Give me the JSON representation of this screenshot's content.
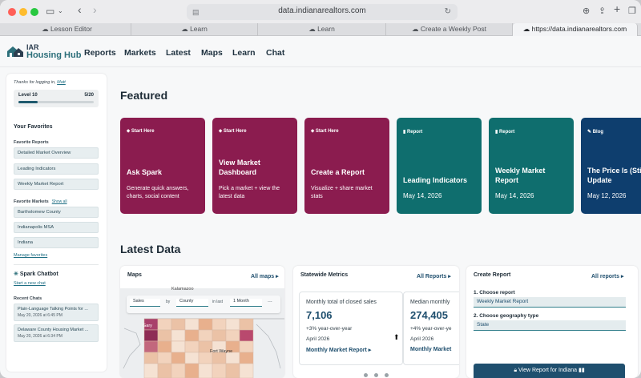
{
  "browser": {
    "url": "data.indianarealtors.com",
    "tabs": [
      "Lesson Editor",
      "Learn",
      "Learn",
      "Create a Weekly Post",
      "https://data.indianarealtors.com"
    ]
  },
  "site": {
    "logo_top": "IAR",
    "logo_bottom": "Housing Hub",
    "nav": [
      "Reports",
      "Markets",
      "Latest",
      "Maps",
      "Learn",
      "Chat"
    ]
  },
  "sidebar": {
    "thanks_prefix": "Thanks for logging in,",
    "user": "Matt",
    "level_label": "Level 10",
    "level_count": "5/20",
    "level_progress": 0.25,
    "favorites_heading": "Your Favorites",
    "favorite_reports_heading": "Favorite Reports",
    "favorite_reports": [
      "Detailed Market Overview",
      "Leading Indicators",
      "Weekly Market Report"
    ],
    "favorite_markets_heading": "Favorite Markets",
    "show_all": "Show all",
    "favorite_markets": [
      "Bartholomew County",
      "Indianapolis MSA",
      "Indiana"
    ],
    "manage_favorites": "Manage favorites",
    "chatbot_heading": "Spark Chatbot",
    "start_chat": "Start a new chat",
    "recent_chats_heading": "Recent Chats",
    "recent_chats": [
      {
        "title": "Plain-Language Talking Points for ...",
        "date": "May 20, 2026 at 6:45 PM"
      },
      {
        "title": "Delaware County Housing Market ...",
        "date": "May 20, 2026 at 6:34 PM"
      }
    ]
  },
  "featured": {
    "heading": "Featured",
    "cards": [
      {
        "kind": "Start Here",
        "title": "Ask Spark",
        "desc": "Generate quick answers, charts, social content",
        "color": "#8b1c4f"
      },
      {
        "kind": "Start Here",
        "title": "View Market Dashboard",
        "desc": "Pick a market + view the latest data",
        "color": "#8b1c4f"
      },
      {
        "kind": "Start Here",
        "title": "Create a Report",
        "desc": "Visualize + share market stats",
        "color": "#8b1c4f"
      },
      {
        "kind": "Report",
        "title": "Leading Indicators",
        "date": "May 14, 2026",
        "color": "#0f6e6e"
      },
      {
        "kind": "Report",
        "title": "Weekly Market Report",
        "date": "May 14, 2026",
        "color": "#0f6e6e"
      },
      {
        "kind": "Blog",
        "title": "The Price Is (Still) Right: 2026 Update",
        "date": "May 12, 2026",
        "color": "#0e3e6e"
      }
    ]
  },
  "latest": {
    "heading": "Latest Data",
    "maps": {
      "title": "Maps",
      "link": "All maps",
      "filter_value": "Sales",
      "filter_by": "by",
      "filter_geo": "County",
      "filter_in_last": "in last",
      "filter_period": "1 Month",
      "more": "...",
      "place_labels": [
        "Kalamazoo",
        "Gary",
        "Fort Wayne"
      ]
    },
    "metrics": {
      "title": "Statewide Metrics",
      "link": "All Reports",
      "cards": [
        {
          "label": "Monthly total of closed sales",
          "value": "7,106",
          "change": "+3% year-over-year",
          "date": "April 2026",
          "link": "Monthly Market Report"
        },
        {
          "label": "Median monthly",
          "value": "274,405",
          "change": "+4% year-over-ye",
          "date": "April 2026",
          "link": "Monthly Market"
        }
      ]
    },
    "create_report": {
      "title": "Create Report",
      "link": "All reports",
      "step1": "1. Choose report",
      "step1_value": "Weekly Market Report",
      "step2": "2. Choose geography type",
      "step2_value": "State",
      "button": "View Report for Indiana"
    }
  }
}
